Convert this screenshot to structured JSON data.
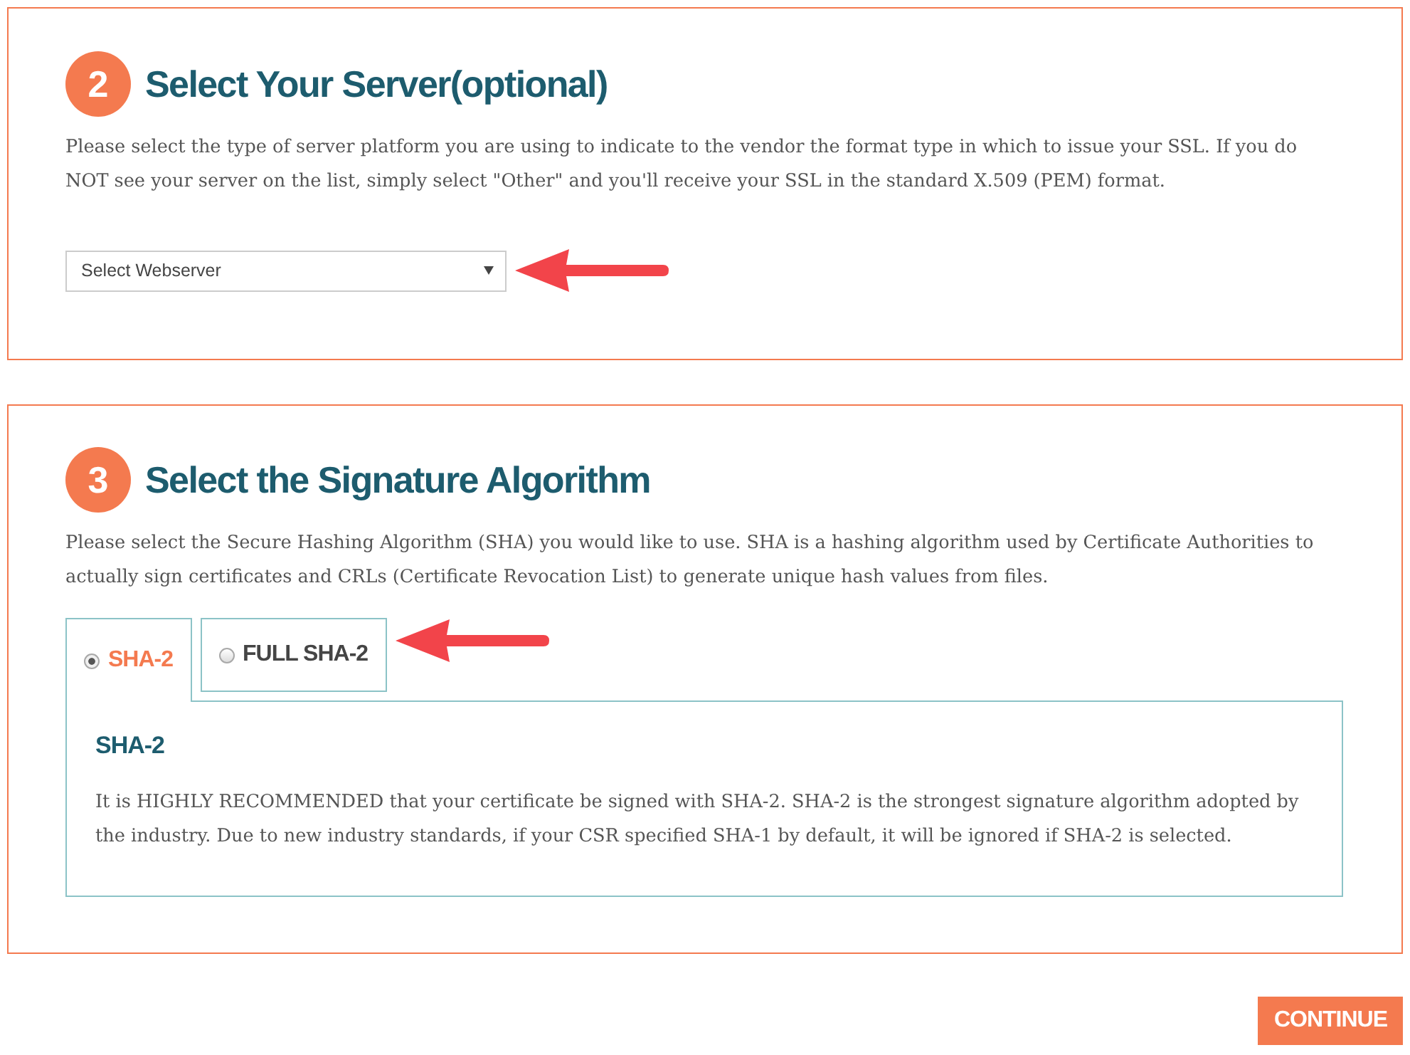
{
  "sections": [
    {
      "kind": "select",
      "step": "2",
      "title": "Select Your Server(optional)",
      "description": "Please select the type of server platform you are using to indicate to the vendor the format type in which to issue your SSL. If you do NOT see your server on the list, simply select \"Other\" and you'll receive your SSL in the standard X.509 (PEM) format.",
      "select": {
        "value": "Select Webserver"
      }
    },
    {
      "kind": "tabs",
      "step": "3",
      "title": "Select the Signature Algorithm",
      "description": "Please select the Secure Hashing Algorithm (SHA) you would like to use. SHA is a hashing algorithm used by Certificate Authorities to actually sign certificates and CRLs (Certificate Revocation List) to generate unique hash values from files.",
      "tabs": [
        {
          "label": "SHA-2",
          "selected": true
        },
        {
          "label": "FULL SHA-2",
          "selected": false
        }
      ],
      "tab_panel": {
        "title": "SHA-2",
        "text": "It is HIGHLY RECOMMENDED that your certificate be signed with SHA-2. SHA-2 is the strongest signature algorithm adopted by the industry. Due to new industry standards, if your CSR specified SHA-1 by default, it will be ignored if SHA-2 is selected."
      }
    }
  ],
  "continue_button": "CONTINUE"
}
